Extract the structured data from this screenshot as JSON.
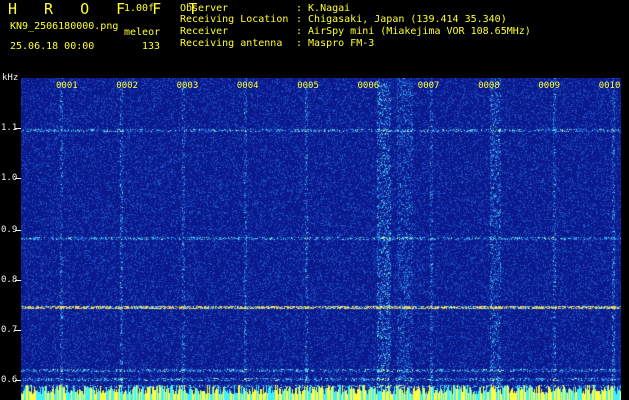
{
  "app": {
    "title": "H R O F F T",
    "version": "1.00f",
    "file": "KN9_2506180000.png",
    "mode": "meleor",
    "datetime": "25.06.18 00:00",
    "count": "133"
  },
  "header": {
    "observer_label": "Observer",
    "observer_value": ": K.Nagai",
    "location_label": "Receiving Location",
    "location_value": ": Chigasaki, Japan (139.414 35.340)",
    "receiver_label": "Receiver",
    "receiver_value": ": AirSpy mini (Miakejima VOR 108.65MHz)",
    "antenna_label": "Receiving antenna",
    "antenna_value": ": Maspro FM-3"
  },
  "axis": {
    "unit": "kHz",
    "y_ticks": [
      "1.1",
      "1.0",
      "0.9",
      "0.8",
      "0.7",
      "0.6"
    ],
    "x_ticks": [
      "0001",
      "0002",
      "0003",
      "0004",
      "0005",
      "0006",
      "0007",
      "0008",
      "0009",
      "0010"
    ]
  },
  "colors": {
    "background": "#0b1b8a",
    "text_yellow": "#ffff33",
    "text_white": "#f2f2f2"
  }
}
